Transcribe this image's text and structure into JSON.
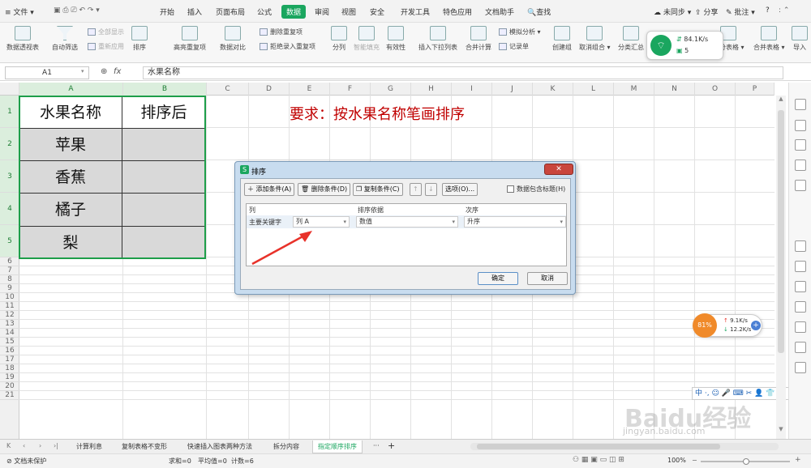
{
  "menubar": {
    "file": "文件",
    "tabs": [
      "开始",
      "插入",
      "页面布局",
      "公式",
      "数据",
      "审阅",
      "视图",
      "安全",
      "开发工具",
      "特色应用",
      "文档助手"
    ],
    "active_tab": "数据",
    "search": "查找",
    "sync": "未同步",
    "share": "分享",
    "comment": "批注",
    "help": "?"
  },
  "ribbon": {
    "pivot": "数据透视表",
    "autofilter": "自动筛选",
    "show_all": "全部显示",
    "reapply": "重新应用",
    "sort": "排序",
    "highlight_dup": "高亮重复项",
    "data_compare": "数据对比",
    "remove_dup": "删除重复项",
    "reject_dup": "拒绝录入重复项",
    "split": "分列",
    "smart_fill": "智能填充",
    "validity": "有效性",
    "insert_dropdown": "插入下拉列表",
    "consolidate": "合并计算",
    "simulate": "模拟分析",
    "record": "记录单",
    "create_group": "创建组",
    "ungroup": "取消组合",
    "subtotal": "分类汇总",
    "split_table": "拆分表格",
    "merge_table": "合并表格",
    "import": "导入"
  },
  "namebox": "A1",
  "fx": "fx",
  "formula": "水果名称",
  "columns": [
    "A",
    "B",
    "C",
    "D",
    "E",
    "F",
    "G",
    "H",
    "I",
    "J",
    "K",
    "L",
    "M",
    "N",
    "O",
    "P"
  ],
  "rows": [
    "1",
    "2",
    "3",
    "4",
    "5",
    "6",
    "7",
    "8",
    "9",
    "10",
    "11",
    "12",
    "13",
    "14",
    "15",
    "16",
    "17",
    "18",
    "19",
    "20",
    "21"
  ],
  "cells": {
    "a1": "水果名称",
    "b1": "排序后",
    "a2": "苹果",
    "a3": "香蕉",
    "a4": "橘子",
    "a5": "梨"
  },
  "requirement": "要求：按水果名称笔画排序",
  "dialog": {
    "title": "排序",
    "close": "✕",
    "add_condition": "添加条件(A)",
    "delete_condition": "删除条件(D)",
    "copy_condition": "复制条件(C)",
    "options": "选项(O)...",
    "has_header": "数据包含标题(H)",
    "col_header": "列",
    "basis_header": "排序依据",
    "order_header": "次序",
    "primary_key": "主要关键字",
    "column_value": "列 A",
    "basis_value": "数值",
    "order_value": "升序",
    "ok": "确定",
    "cancel": "取消"
  },
  "sheet_tabs": [
    "计算利息",
    "复制表格不变形",
    "快速插入图表两种方法",
    "拆分内容",
    "指定顺序排序"
  ],
  "active_sheet": "指定顺序排序",
  "status": {
    "protect": "文档未保护",
    "sum": "求和=0",
    "avg": "平均值=0",
    "count": "计数=6",
    "zoom": "100%"
  },
  "net_widget": {
    "down": "84.1K/s",
    "count": "5"
  },
  "net_widget2": {
    "percent": "81%",
    "up": "9.1K/s",
    "down": "12.2K/s"
  },
  "ime": "中 ·, ☺ 🎤 ⌨ ✂ 👤 👕 ⚙",
  "watermark": "Baidu经验",
  "watermark_url": "jingyan.baidu.com",
  "colors": {
    "accent": "#1aa65f",
    "requirement": "#c00000",
    "selection": "#1e9e4a",
    "cell_fill": "#d9d9d9"
  }
}
